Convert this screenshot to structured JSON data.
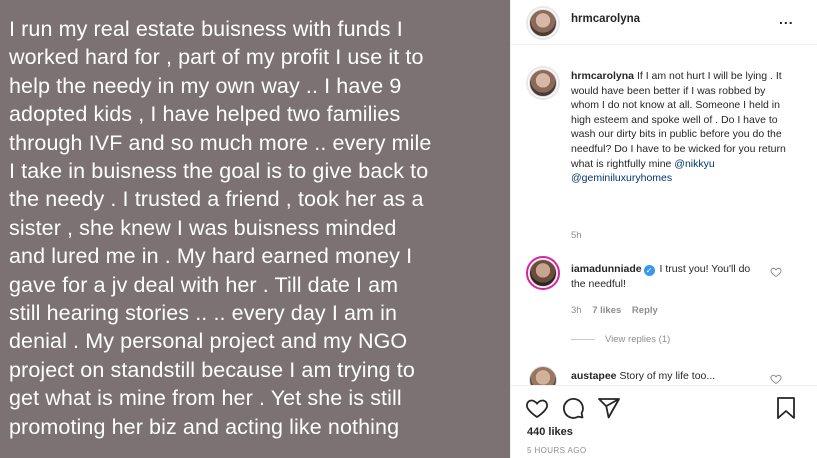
{
  "post": {
    "text": "I run my real estate buisness with funds I\nworked hard for , part of my profit I use it to\nhelp the needy in my own way .. I have 9\nadopted kids , I have helped two families\nthrough IVF and so much more .. every mile\nI take in buisness the goal is to give back to\nthe needy  . I trusted a friend , took her as a\nsister , she knew I was buisness minded\nand lured me in . My hard earned money I\ngave  for a jv deal with her  . Till date I am\nstill hearing stories .. .. every day I am in\ndenial . My personal project and my NGO\nproject on standstill because I am trying to\nget what is mine from her . Yet she is still\npromoting her biz and acting like nothing"
  },
  "header": {
    "username": "hrmcarolyna",
    "more_label": "..."
  },
  "caption": {
    "username": "hrmcarolyna",
    "text": "If I am not hurt I will be lying . It would have been better if I was robbed by whom I do not know at all. Someone I held in high esteem and spoke well of . Do I have to wash our dirty bits in public before you do the needful? Do I have to be wicked for you return what is rightfully mine",
    "mention1": "@nikkyu",
    "mention2": "@geminiluxuryhomes",
    "time": "5h"
  },
  "comments": [
    {
      "username": "iamadunniade",
      "verified": true,
      "text": "I trust you! You'll do the needful!",
      "time": "3h",
      "likes": "7 likes",
      "reply_label": "Reply",
      "view_replies": "View replies (1)"
    },
    {
      "username": "austapee",
      "text": "Story of my life too..."
    }
  ],
  "actions": {
    "likes": "440 likes",
    "time": "5 HOURS AGO"
  },
  "icons": {
    "like": "heart-icon",
    "comment": "comment-icon",
    "share": "send-icon",
    "save": "bookmark-icon"
  }
}
